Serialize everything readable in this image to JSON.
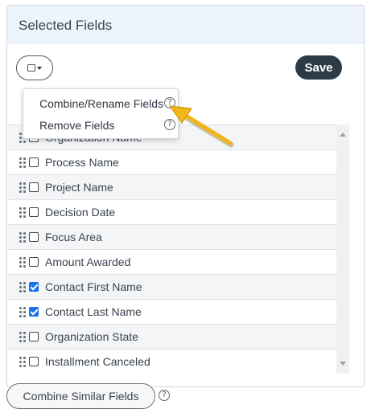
{
  "header": {
    "title": "Selected Fields"
  },
  "toolbar": {
    "save_label": "Save"
  },
  "menu": {
    "items": [
      {
        "label": "Combine/Rename Fields"
      },
      {
        "label": "Remove Fields"
      }
    ],
    "help_glyph": "?"
  },
  "fields": [
    {
      "label": "Organization Name",
      "checked": false
    },
    {
      "label": "Process Name",
      "checked": false
    },
    {
      "label": "Project Name",
      "checked": false
    },
    {
      "label": "Decision Date",
      "checked": false
    },
    {
      "label": "Focus Area",
      "checked": false
    },
    {
      "label": "Amount Awarded",
      "checked": false
    },
    {
      "label": "Contact First Name",
      "checked": true
    },
    {
      "label": "Contact Last Name",
      "checked": true
    },
    {
      "label": "Organization State",
      "checked": false
    },
    {
      "label": "Installment Canceled",
      "checked": false
    }
  ],
  "footer": {
    "combine_label": "Combine Similar Fields",
    "help_glyph": "?"
  },
  "colors": {
    "header_bg": "#eef4fb",
    "save_bg": "#2d3a48",
    "checkbox_checked": "#1a73e8",
    "annotation_arrow": "#f2b61b"
  }
}
